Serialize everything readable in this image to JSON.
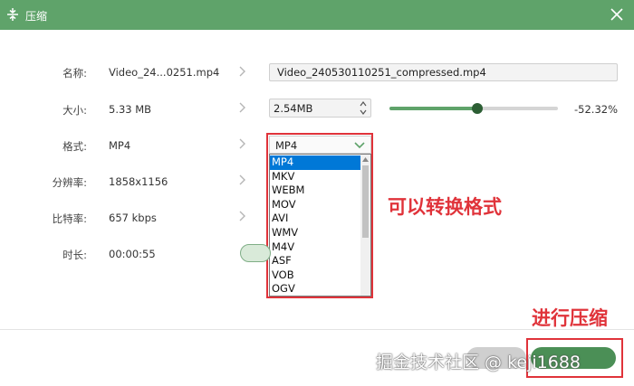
{
  "window": {
    "title": "压缩",
    "icon": "compress-icon",
    "close_icon": "close-icon",
    "accent_color": "#5fa36a"
  },
  "rows": {
    "name": {
      "label": "名称:",
      "value": "Video_24...0251.mp4",
      "output": "Video_240530110251_compressed.mp4"
    },
    "size": {
      "label": "大小:",
      "value": "5.33 MB",
      "output": "2.54MB",
      "slider_level": 0.52,
      "percent": "-52.32%"
    },
    "format": {
      "label": "格式:",
      "value": "MP4",
      "selected": "MP4"
    },
    "resolution": {
      "label": "分辨率:",
      "value": "1858x1156"
    },
    "bitrate": {
      "label": "比特率:",
      "value": "657 kbps"
    },
    "duration": {
      "label": "时长:",
      "value": "00:00:55"
    }
  },
  "format_options": [
    "MP4",
    "MKV",
    "WEBM",
    "MOV",
    "AVI",
    "WMV",
    "M4V",
    "ASF",
    "VOB",
    "OGV"
  ],
  "annotations": {
    "format_note": "可以转换格式",
    "compress_note": "进行压缩",
    "color": "#e0333a"
  },
  "watermark": "掘金技术社区 @ keji1688"
}
